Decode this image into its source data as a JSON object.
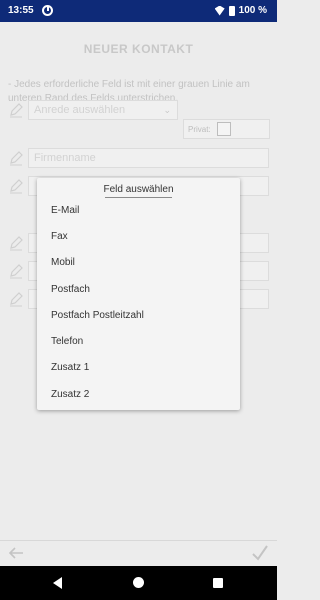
{
  "status_bar": {
    "time": "13:55",
    "battery": "100 %"
  },
  "form": {
    "title": "NEUER KONTAKT",
    "hint": "- Jedes erforderliche Feld ist mit einer grauen Linie am unteren Rand des Felds unterstrichen.",
    "salutation_placeholder": "Anrede auswählen",
    "privat_label": "Privat:",
    "company_placeholder": "Firmenname"
  },
  "popup": {
    "title": "Feld auswählen",
    "options": [
      "E-Mail",
      "Fax",
      "Mobil",
      "Postfach",
      "Postfach Postleitzahl",
      "Telefon",
      "Zusatz 1",
      "Zusatz 2"
    ]
  }
}
